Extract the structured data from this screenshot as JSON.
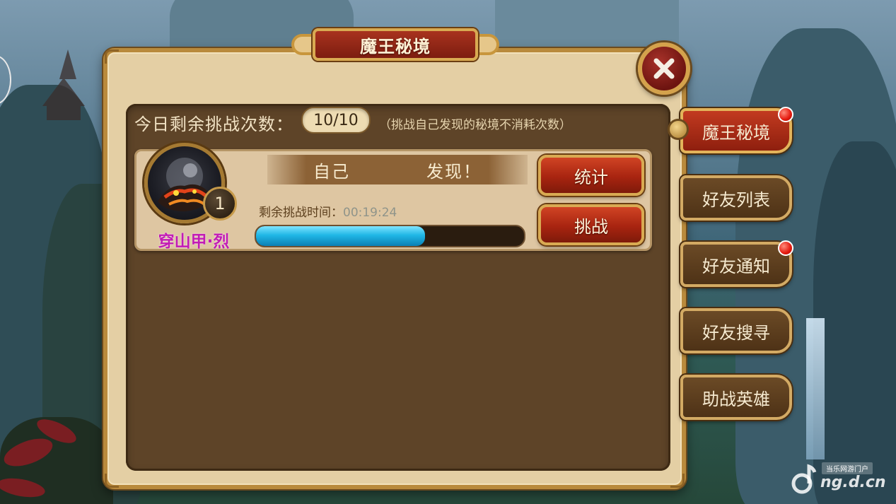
{
  "window": {
    "title": "魔王秘境"
  },
  "challenges": {
    "label": "今日剩余挑战次数：",
    "count": "10/10",
    "hint": "（挑战自己发现的秘境不消耗次数）"
  },
  "realm_card": {
    "hero_name": "穿山甲·烈",
    "level": "1",
    "finder_left": "自己",
    "finder_right": "发现！",
    "time_label": "剩余挑战时间：",
    "time_value": "00:19:24",
    "time_progress_fraction": 0.63,
    "stats_button": "统计",
    "challenge_button": "挑战"
  },
  "side_tabs": [
    {
      "label": "魔王秘境",
      "active": true,
      "notification": true
    },
    {
      "label": "好友列表",
      "active": false,
      "notification": false
    },
    {
      "label": "好友通知",
      "active": false,
      "notification": true
    },
    {
      "label": "好友搜寻",
      "active": false,
      "notification": false
    },
    {
      "label": "助战英雄",
      "active": false,
      "notification": false
    }
  ],
  "watermark": {
    "tag": "当乐网游门户",
    "text": "ng.d.cn"
  },
  "colors": {
    "panel": "#e4cfa4",
    "inner": "#5e4428",
    "accent_red": "#a82410",
    "gold": "#d9aa52",
    "progress": "#20b7e6",
    "hero_name": "#c21bb5"
  }
}
